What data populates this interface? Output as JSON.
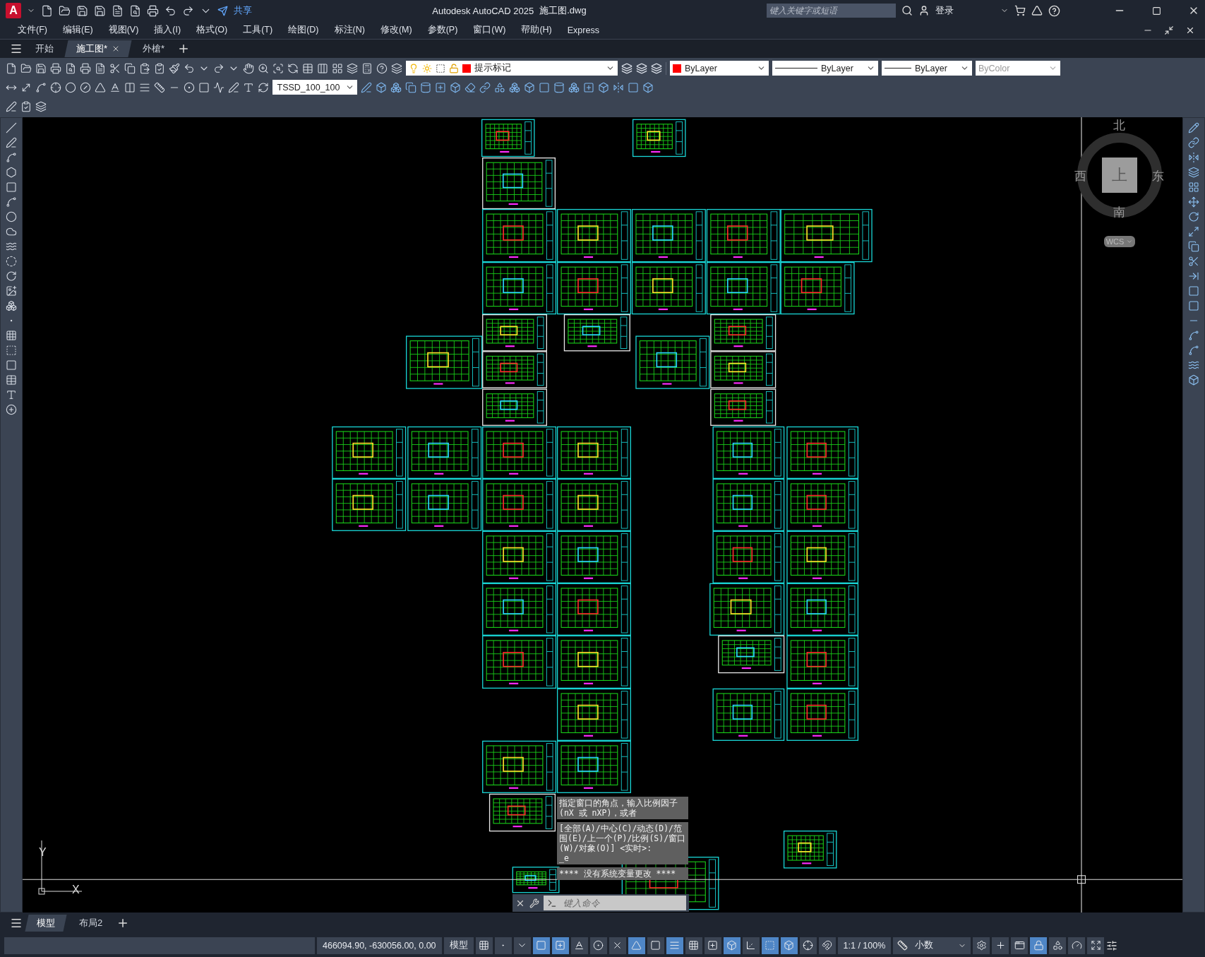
{
  "title_bar": {
    "app_logo": "A",
    "share": "共享",
    "app_title": "Autodesk AutoCAD 2025",
    "file_name": "施工图.dwg",
    "search": {
      "placeholder": "键入关键字或短语"
    },
    "login": "登录"
  },
  "menu_bar": {
    "items": [
      "文件(F)",
      "编辑(E)",
      "视图(V)",
      "插入(I)",
      "格式(O)",
      "工具(T)",
      "绘图(D)",
      "标注(N)",
      "修改(M)",
      "参数(P)",
      "窗口(W)",
      "帮助(H)",
      "Express"
    ]
  },
  "file_tabs": [
    {
      "label": "开始",
      "selected": false
    },
    {
      "label": "施工图*",
      "selected": true
    },
    {
      "label": "外槍*",
      "selected": false
    }
  ],
  "properties": {
    "layer": {
      "value": "提示标记",
      "color": "#ff0000"
    },
    "color": {
      "value": "ByLayer",
      "color": "#ff0000"
    },
    "linetype": {
      "value": "ByLayer"
    },
    "lineweight": {
      "value": "ByLayer"
    },
    "plot_style": {
      "value": "ByColor",
      "disabled": true
    }
  },
  "dim_style": {
    "value": "TSSD_100_100"
  },
  "viewcube": {
    "north": "北",
    "south": "南",
    "east": "东",
    "west": "西",
    "face": "上",
    "coordinate_system": "WCS"
  },
  "ucs_icon": {
    "x_label": "X",
    "y_label": "Y"
  },
  "command_history": [
    {
      "lines": [
        "指定窗口的角点，输入比例因子 (nX 或 nXP)，或者"
      ]
    },
    {
      "lines": [
        "[全部(A)/中心(C)/动态(D)/范围(E)/上一个(P)/比例(S)/窗口(W)/对象(O)] <实时>:",
        "_e"
      ]
    },
    {
      "lines": [
        "**** 没有系统变量更改 ****"
      ]
    }
  ],
  "command_line": {
    "placeholder": "键入命令"
  },
  "layout_tabs": [
    {
      "label": "模型",
      "selected": true
    },
    {
      "label": "布局2",
      "selected": false
    }
  ],
  "status_bar": {
    "coordinates": "466094.90, -630056.00, 0.00",
    "space": "模型",
    "toggles": [
      {
        "on": false
      },
      {
        "on": false
      },
      {
        "on": false
      },
      {
        "on": true
      },
      {
        "on": true
      },
      {
        "on": false
      },
      {
        "on": false
      },
      {
        "on": false
      },
      {
        "on": true
      },
      {
        "on": false
      },
      {
        "on": true
      },
      {
        "on": false
      },
      {
        "on": false
      },
      {
        "on": true
      },
      {
        "on": false
      },
      {
        "on": true
      },
      {
        "on": true
      },
      {
        "on": false
      },
      {
        "on": false
      }
    ],
    "annotation_scale": "1:1 / 100%",
    "units": "小数",
    "right_toggles": [
      {
        "on": false
      },
      {
        "on": false
      },
      {
        "on": false
      },
      {
        "on": true
      },
      {
        "on": false
      },
      {
        "on": false
      },
      {
        "on": false
      }
    ]
  }
}
